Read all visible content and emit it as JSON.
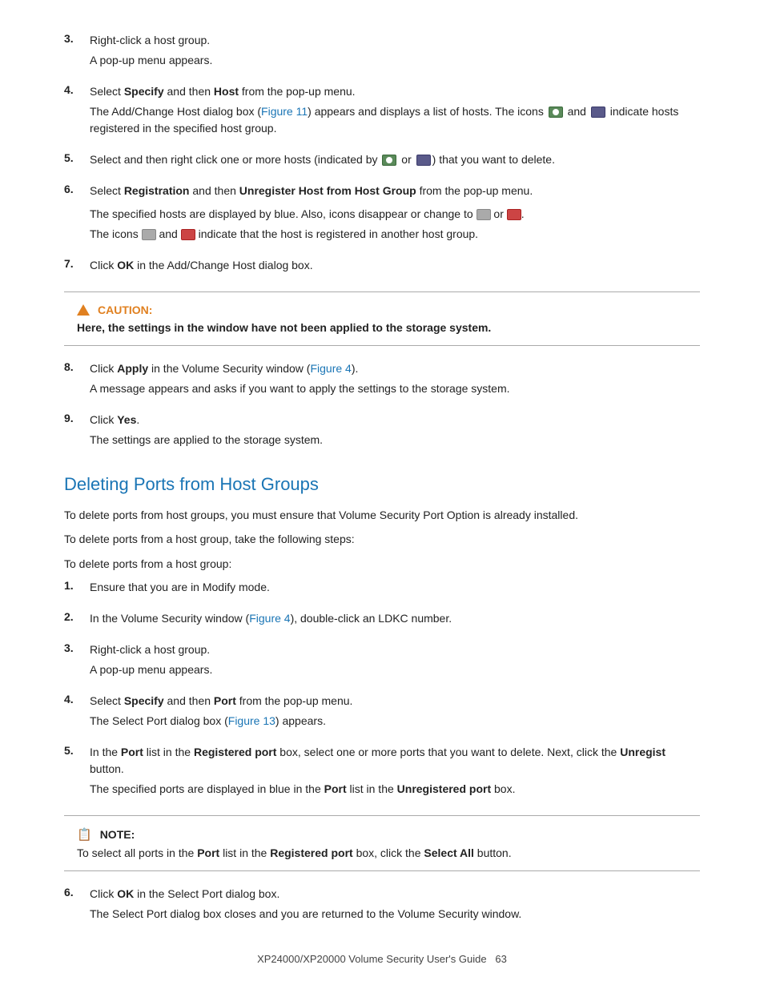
{
  "steps_top": [
    {
      "num": "3.",
      "main": "Right-click a host group.",
      "sub": "A pop-up menu appears."
    },
    {
      "num": "4.",
      "main": "Select <b>Specify</b> and then <b>Host</b> from the pop-up menu.",
      "sub": "The Add/Change Host dialog box (<a class=\"link\">Figure 11</a>) appears and displays a list of hosts. The icons [icon1] and [icon2] indicate hosts registered in the specified host group."
    },
    {
      "num": "5.",
      "main": "Select and then right click one or more hosts (indicated by [icon1] or [icon2]) that you want to delete.",
      "sub": ""
    },
    {
      "num": "6.",
      "main": "Select <b>Registration</b> and then <b>Unregister Host from Host Group</b> from the pop-up menu.",
      "sub_lines": [
        "The specified hosts are displayed by blue. Also, icons disappear or change to [icon3] or [icon4].",
        "The icons [icon3] and [icon4] indicate that the host is registered in another host group."
      ]
    },
    {
      "num": "7.",
      "main": "Click <b>OK</b> in the Add/Change Host dialog box.",
      "sub": ""
    }
  ],
  "caution": {
    "title": "CAUTION:",
    "text": "Here, the settings in the window have not been applied to the storage system."
  },
  "steps_mid": [
    {
      "num": "8.",
      "main": "Click <b>Apply</b> in the Volume Security window (<a class=\"link\">Figure 4</a>).",
      "sub": "A message appears and asks if you want to apply the settings to the storage system."
    },
    {
      "num": "9.",
      "main": "Click <b>Yes</b>.",
      "sub": "The settings are applied to the storage system."
    }
  ],
  "section_heading": "Deleting Ports from Host Groups",
  "intro_lines": [
    "To delete ports from host groups, you must ensure that Volume Security Port Option is already installed.",
    "To delete ports from a host group, take the following steps:",
    "To delete ports from a host group:"
  ],
  "steps_section": [
    {
      "num": "1.",
      "main": "Ensure that you are in Modify mode.",
      "sub": ""
    },
    {
      "num": "2.",
      "main": "In the Volume Security window (<a class=\"link\">Figure 4</a>), double-click an LDKC number.",
      "sub": ""
    },
    {
      "num": "3.",
      "main": "Right-click a host group.",
      "sub": "A pop-up menu appears."
    },
    {
      "num": "4.",
      "main": "Select <b>Specify</b> and then <b>Port</b> from the pop-up menu.",
      "sub": "The Select Port dialog box (<a class=\"link\">Figure 13</a>) appears."
    },
    {
      "num": "5.",
      "main": "In the <b>Port</b> list in the <b>Registered port</b> box, select one or more ports that you want to delete. Next, click the <b>Unregist</b> button.",
      "sub": "The specified ports are displayed in blue in the <b>Port</b> list in the <b>Unregistered port</b> box."
    }
  ],
  "note": {
    "title": "NOTE:",
    "text": "To select all ports in the <b>Port</b> list in the <b>Registered port</b> box, click the <b>Select All</b> button."
  },
  "steps_after_note": [
    {
      "num": "6.",
      "main": "Click <b>OK</b> in the Select Port dialog box.",
      "sub": "The Select Port dialog box closes and you are returned to the Volume Security window."
    }
  ],
  "footer": {
    "text": "XP24000/XP20000 Volume Security User's Guide",
    "page": "63"
  }
}
